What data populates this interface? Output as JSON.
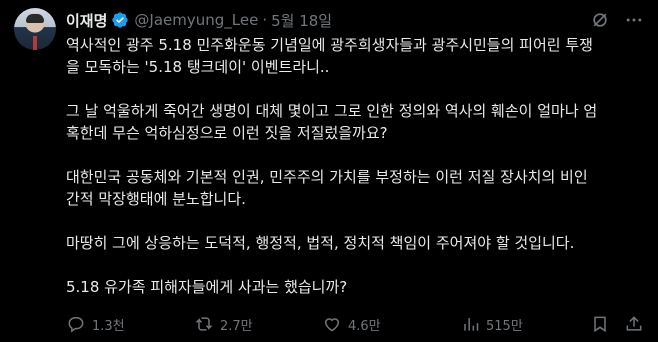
{
  "author": {
    "name": "이재명",
    "handle": "@Jaemyung_Lee",
    "date": "5월 18일"
  },
  "tweet": {
    "paragraphs": [
      "역사적인 광주 5.18 민주화운동 기념일에 광주희생자들과 광주시민들의 피어린 투쟁\n을 모독하는 '5.18 탱크데이' 이벤트라니..",
      "그 날 억울하게 죽어간 생명이 대체 몇이고 그로 인한 정의와 역사의 훼손이 얼마나 엄\n혹한데 무슨 억하심정으로 이런 짓을 저질렀을까요?",
      "대한민국 공동체와 기본적 인권, 민주주의 가치를 부정하는 이런 저질 장사치의 비인\n간적 막장행태에 분노합니다.",
      "마땅히 그에 상응하는 도덕적, 행정적, 법적, 정치적 책임이 주어져야 할 것입니다.",
      "5.18 유가족 피해자들에게 사과는 했습니까?"
    ]
  },
  "actions": {
    "replies": "1.3천",
    "retweets": "2.7만",
    "likes": "4.6만",
    "views": "515만"
  },
  "icons": {
    "verified": "verified-badge-icon",
    "grok": "grok-icon",
    "more": "more-icon",
    "reply": "reply-icon",
    "retweet": "retweet-icon",
    "like": "heart-icon",
    "views": "views-icon",
    "bookmark": "bookmark-icon",
    "share": "share-icon"
  },
  "colors": {
    "background": "#000000",
    "text": "#e7e9ea",
    "muted": "#71767b",
    "verified": "#1d9bf0"
  }
}
